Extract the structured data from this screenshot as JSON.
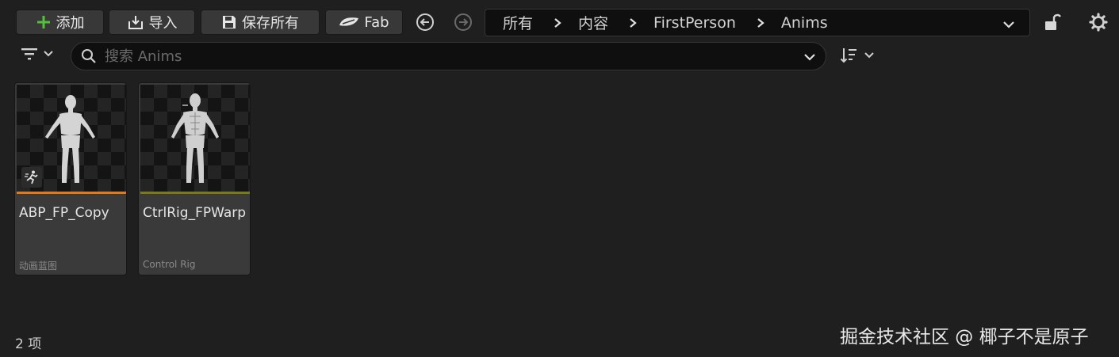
{
  "toolbar": {
    "add_label": "添加",
    "import_label": "导入",
    "save_all_label": "保存所有",
    "fab_label": "Fab"
  },
  "breadcrumbs": [
    "所有",
    "内容",
    "FirstPerson",
    "Anims"
  ],
  "search": {
    "placeholder": "搜索 Anims",
    "value": ""
  },
  "assets": [
    {
      "name": "ABP_FP_Copy",
      "type": "动画蓝图",
      "stripe_color": "#e07a1c",
      "icon": "running-man-icon"
    },
    {
      "name": "CtrlRig_FPWarp",
      "type": "Control Rig",
      "stripe_color": "#7a7a1a",
      "icon": ""
    }
  ],
  "status": {
    "item_count": "2 项"
  },
  "watermark": "掘金技术社区 @ 椰子不是原子",
  "colors": {
    "accent_green": "#53c13a",
    "background": "#1f1f1f",
    "tile": "#3a3a3a"
  },
  "icons": [
    "plus-icon",
    "import-icon",
    "save-icon",
    "fab-icon",
    "back-arrow-icon",
    "forward-arrow-icon",
    "chevron-right-icon",
    "chevron-down-icon",
    "lock-icon",
    "gear-icon",
    "filter-icon",
    "search-icon",
    "sort-icon"
  ]
}
